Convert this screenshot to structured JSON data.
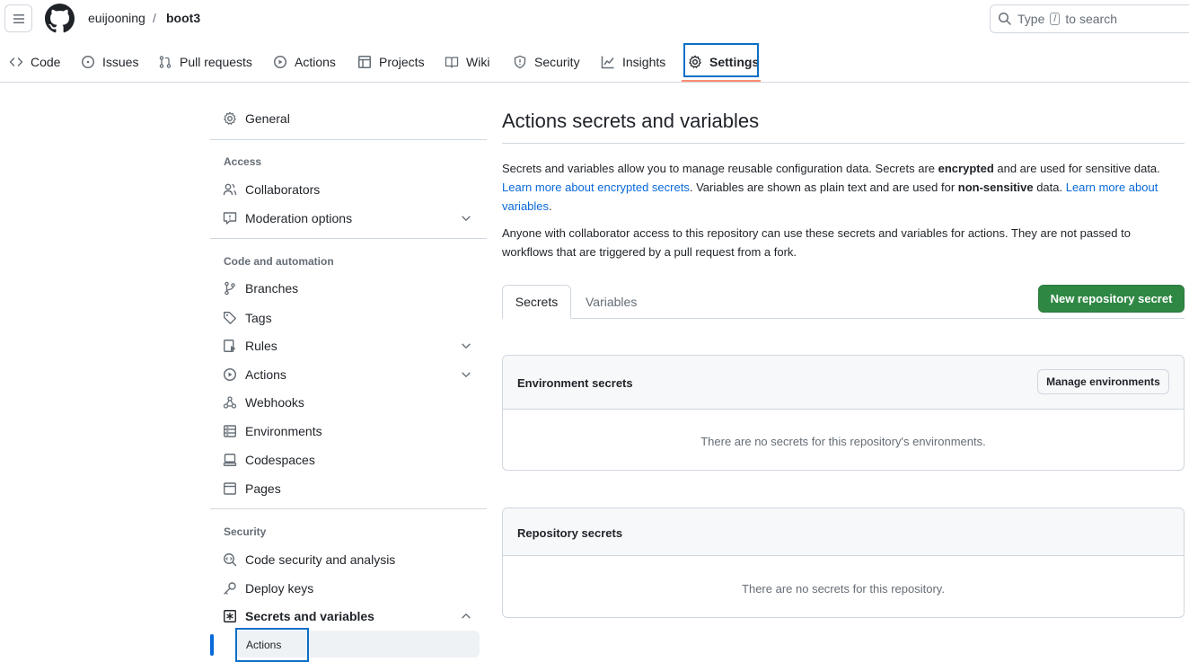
{
  "header": {
    "owner": "euijooning",
    "separator": "/",
    "repo": "boot3",
    "search_placeholder_pre": "Type",
    "search_key": "/",
    "search_placeholder_post": "to search"
  },
  "repo_tabs": [
    {
      "label": "Code",
      "icon": "code-icon"
    },
    {
      "label": "Issues",
      "icon": "issue-icon"
    },
    {
      "label": "Pull requests",
      "icon": "pull-request-icon"
    },
    {
      "label": "Actions",
      "icon": "play-icon"
    },
    {
      "label": "Projects",
      "icon": "table-icon"
    },
    {
      "label": "Wiki",
      "icon": "book-icon"
    },
    {
      "label": "Security",
      "icon": "shield-icon"
    },
    {
      "label": "Insights",
      "icon": "graph-icon"
    },
    {
      "label": "Settings",
      "icon": "gear-icon",
      "selected": true
    }
  ],
  "sidebar": {
    "general": "General",
    "access_heading": "Access",
    "collaborators": "Collaborators",
    "moderation": "Moderation options",
    "code_heading": "Code and automation",
    "branches": "Branches",
    "tags": "Tags",
    "rules": "Rules",
    "actions": "Actions",
    "webhooks": "Webhooks",
    "environments": "Environments",
    "codespaces": "Codespaces",
    "pages": "Pages",
    "security_heading": "Security",
    "code_security": "Code security and analysis",
    "deploy_keys": "Deploy keys",
    "secrets_vars": "Secrets and variables",
    "sub_actions": "Actions"
  },
  "main": {
    "title": "Actions secrets and variables",
    "p1_a": "Secrets and variables allow you to manage reusable configuration data. Secrets are ",
    "p1_b": "encrypted",
    "p1_c": " and are used for sensitive data. ",
    "p1_link1": "Learn more about encrypted secrets",
    "p1_d": ". Variables are shown as plain text and are used for ",
    "p1_e": "non-sensitive",
    "p1_f": " data. ",
    "p1_link2": "Learn more about variables",
    "p1_g": ".",
    "p2": "Anyone with collaborator access to this repository can use these secrets and variables for actions. They are not passed to workflows that are triggered by a pull request from a fork.",
    "tab_secrets": "Secrets",
    "tab_variables": "Variables",
    "new_secret_button": "New repository secret",
    "env_title": "Environment secrets",
    "manage_env_button": "Manage environments",
    "env_empty": "There are no secrets for this repository's environments.",
    "repo_title": "Repository secrets",
    "repo_empty": "There are no secrets for this repository."
  },
  "colors": {
    "accent_link": "#0969da",
    "primary_button": "#2f8744",
    "highlight_box": "#0b6fc7",
    "tab_underline": "#fd8c73"
  }
}
